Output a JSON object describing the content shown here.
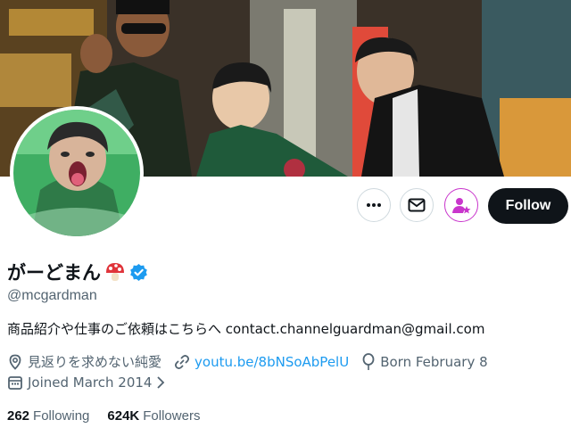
{
  "profile": {
    "display_name": "がーどまん",
    "handle": "@mcgardman",
    "bio": "商品紹介や仕事のご依頼はこちらへ contact.channelguardman@gmail.com",
    "location": "見返りを求めない純愛",
    "website": "youtu.be/8bNSoAbPelU",
    "birthday": "Born February 8",
    "joined": "Joined March 2014",
    "following_count": "262",
    "following_label": "Following",
    "followers_count": "624K",
    "followers_label": "Followers"
  },
  "actions": {
    "follow_label": "Follow"
  },
  "colors": {
    "verified": "#1d9bf0",
    "link": "#1d9bf0",
    "subscribe": "#c936cc",
    "follow_bg": "#0f1419"
  },
  "icons": {
    "more": "more-icon",
    "message": "mail-icon",
    "subscribe": "subscribe-icon",
    "verified": "verified-badge-icon",
    "location": "location-icon",
    "link": "link-icon",
    "birthday": "balloon-icon",
    "calendar": "calendar-icon"
  }
}
